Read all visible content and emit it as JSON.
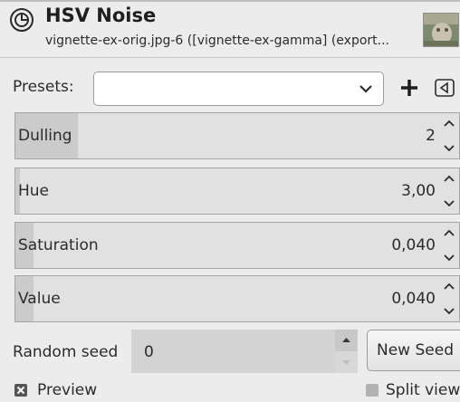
{
  "header": {
    "title": "HSV Noise",
    "subtitle": "vignette-ex-orig.jpg-6 ([vignette-ex-gamma] (export..."
  },
  "presets": {
    "label": "Presets:",
    "selected": ""
  },
  "parameters": [
    {
      "label": "Dulling",
      "value": "2",
      "fill_fraction": 0.14
    },
    {
      "label": "Hue",
      "value": "3,00",
      "fill_fraction": 0.01
    },
    {
      "label": "Saturation",
      "value": "0,040",
      "fill_fraction": 0.04
    },
    {
      "label": "Value",
      "value": "0,040",
      "fill_fraction": 0.04
    }
  ],
  "seed": {
    "label": "Random seed",
    "value": "0",
    "new_seed_label": "New Seed"
  },
  "options": {
    "preview_label": "Preview",
    "preview_checked": true,
    "split_view_label": "Split view",
    "split_view_checked": false
  },
  "colors": {
    "background": "#ececec",
    "slider_fill": "#cbcbcb",
    "slider_bg": "#e1e1e1"
  }
}
